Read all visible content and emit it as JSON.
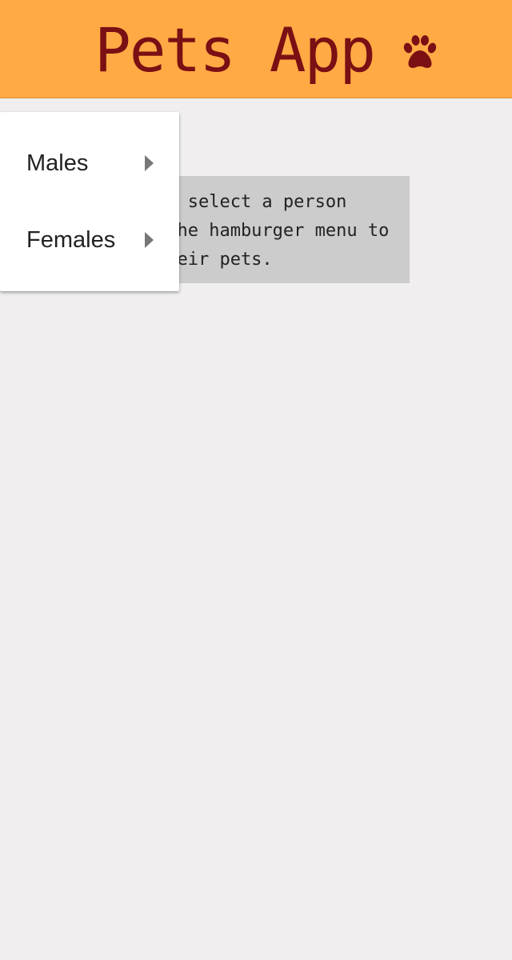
{
  "header": {
    "title": "Pets App",
    "icon": "paw-icon",
    "background_color": "#ffaa44",
    "title_color": "#7a0f14"
  },
  "menu": {
    "items": [
      {
        "label": "Males",
        "icon": "chevron-right-icon"
      },
      {
        "label": "Females",
        "icon": "chevron-right-icon"
      }
    ]
  },
  "main": {
    "message": "Please select a person from the hamburger menu to see their pets."
  }
}
